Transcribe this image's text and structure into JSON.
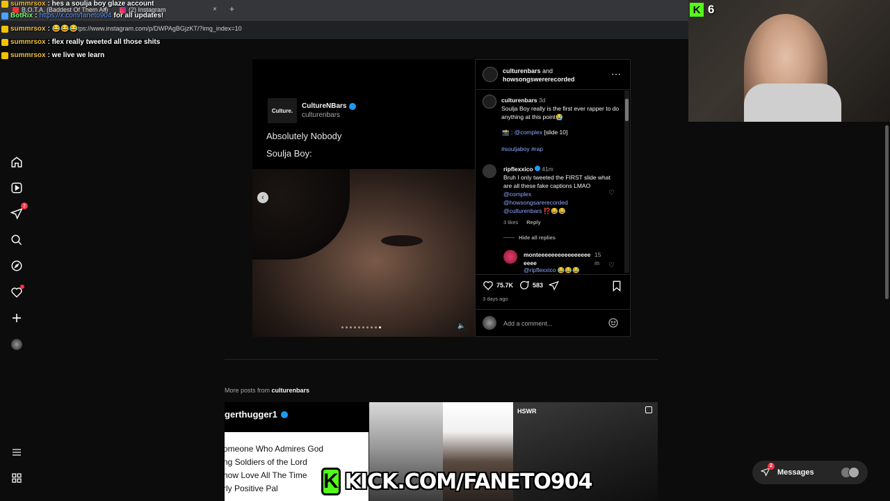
{
  "browser": {
    "tabs": [
      {
        "label": "B.O.T.A. (Baddest Of Them All)",
        "close": "×"
      },
      {
        "label": "(2) Instagram",
        "close": "×"
      }
    ],
    "new_tab": "+",
    "url": "https://www.instagram.com/p/DWPAgBGjzKT/?img_index=10"
  },
  "chat": [
    {
      "user": "summrsox",
      "text": ": hes a soulja boy glaze account"
    },
    {
      "user": "BotRix",
      "link": "https://x.com/faneto904",
      "text": " for all updates!"
    },
    {
      "user": "summrsox",
      "text": ": 😂😂😂"
    },
    {
      "user": "summrsox",
      "text": ": flex really tweeted all those shits"
    },
    {
      "user": "summrsox",
      "text": ": we live we learn"
    }
  ],
  "sidebar": {
    "notif_count": "2"
  },
  "post": {
    "tweet_name": "CultureNBars",
    "tweet_handle": "culturenbars",
    "tweet_line1": "Absolutely Nobody",
    "tweet_line2": "Soulja Boy:",
    "tweet_logo": "Culture.",
    "header_user1": "culturenbars",
    "header_and": "and",
    "header_user2": "howsongswererecorded",
    "caption_user": "culturenbars",
    "caption_time": "3d",
    "caption_text": "Soulja Boy really is the first ever rapper to do anything at this point😭",
    "credit_prefix": "📸 :",
    "credit_handle": "@complex",
    "credit_suffix": "[slide 10]",
    "hashtags": "#souljaboy #rap",
    "comment1_user": "ripflexxico",
    "comment1_time": "41m",
    "comment1_text": "Bruh I only tweeted the FIRST slide what are all these fake captions LMAO",
    "comment1_mention1": "@complex",
    "comment1_mention2": "@howsongsarerecorded",
    "comment1_mention3": "@culturenbars",
    "comment1_emoji": "⁉️😂😂",
    "comment1_likes": "3 likes",
    "comment1_reply": "Reply",
    "hide_replies": "Hide all replies",
    "reply_user": "monteeeeeeeeeeeeeeeeeeee",
    "reply_time": "15 m",
    "reply_mention": "@ripflexxico",
    "reply_emoji": "😂😂😂",
    "likes": "75.7K",
    "comments": "583",
    "posted": "3 days ago",
    "add_comment": "Add a comment..."
  },
  "more_posts": {
    "label": "More posts from",
    "user": "culturenbars",
    "thumb1_name": "gerthugger1",
    "thumb1_lines": [
      "omeone Who Admires God",
      "ng Soldiers of the Lord",
      "how Love All The Time",
      "rly Positive Pal"
    ],
    "thumb4_tag": "HSWR"
  },
  "overlay": {
    "kick_count": "6",
    "kick_banner": "KICK.COM/FANETO904",
    "kick_logo": "K"
  },
  "messages": {
    "label": "Messages",
    "count": "2"
  }
}
